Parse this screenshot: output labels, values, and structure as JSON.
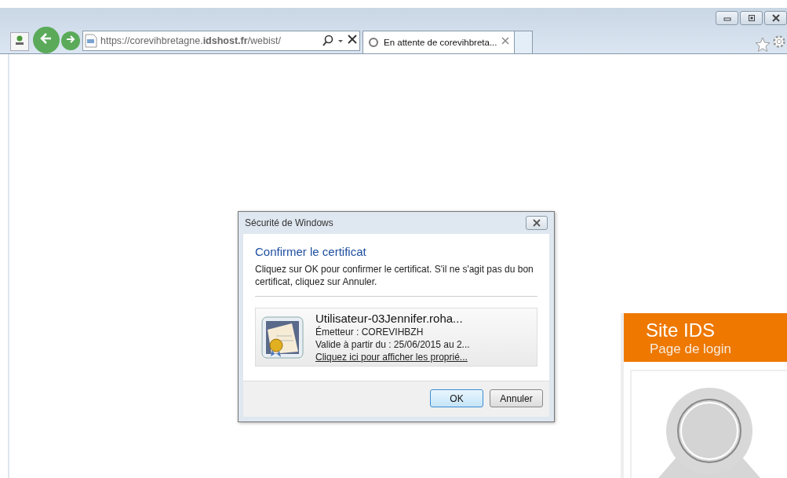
{
  "browser": {
    "address": "https://corevihbretagne.**idshost.fr**/webist/",
    "tabs": [
      {
        "label": "En attente de corevihbreta...",
        "selected": true,
        "loading": true
      }
    ]
  },
  "dialog": {
    "title": "Sécurité de Windows",
    "heading": "Confirmer le certificat",
    "message": "Cliquez sur OK pour confirmer le certificat. S'il ne s'agit pas du bon certificat, cliquez sur Annuler.",
    "certificate": {
      "name": "Utilisateur-03Jennifer.roha...",
      "issuer": "Émetteur : COREVIHBZH",
      "validity": "Valide à partir du : 25/06/2015 au 2...",
      "link": "Cliquez ici pour afficher les proprié..."
    },
    "buttons": [
      {
        "label": "OK",
        "default": true
      },
      {
        "label": "Annuler",
        "default": false
      }
    ]
  },
  "login_panel": {
    "title": "Site IDS",
    "subtitle": "Page de login"
  }
}
